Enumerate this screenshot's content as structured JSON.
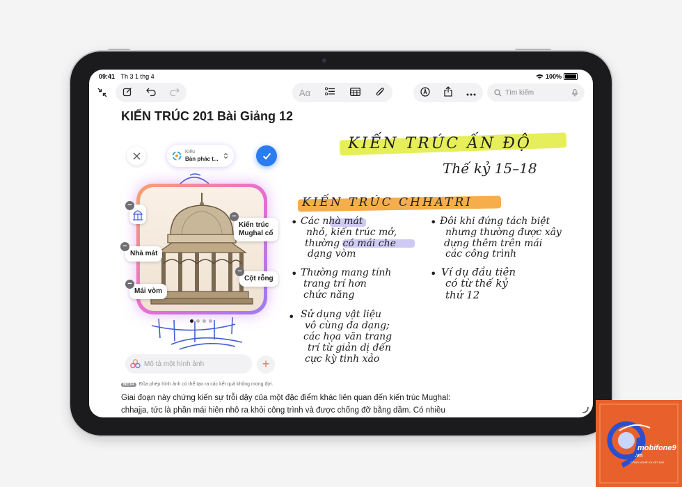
{
  "status_bar": {
    "time": "09:41",
    "date": "Th 3 1 thg 4",
    "battery": "100%"
  },
  "toolbar": {
    "search_placeholder": "Tìm kiếm",
    "format_label": "Aα"
  },
  "note": {
    "title": "KIẾN TRÚC 201 Bài Giảng 12",
    "body": "Giai đoạn này chứng kiến sự trỗi dậy của một đặc điểm khác liên quan đến kiến trúc Mughal: chhajja, tức là phần mái hiên nhô ra khỏi công trình và được chống đỡ bằng dầm. Có nhiều biến"
  },
  "image_playground": {
    "style_label": "Kiểu",
    "style_value": "Bản phác t...",
    "tags": [
      "Kiến trúc Mughal cổ",
      "Nhà mát",
      "Cột rỗng",
      "Mái vòm"
    ],
    "describe_placeholder": "Mô tả một hình ảnh",
    "beta_badge": "BETA",
    "beta_note": "Đũa phép hình ảnh có thể tạo ra các kết quả không mong đợi.",
    "page_dots": 4,
    "active_dot": 1
  },
  "handwriting": {
    "title": "KIẾN TRÚC ẤN ĐỘ",
    "subtitle": "Thế kỷ 15–18",
    "heading": "KIẾN TRÚC CHHATRI",
    "left_bullets": [
      [
        "Các nhà mát",
        "nhỏ, kiến trúc mở,",
        "thường có mái che",
        "dạng vòm"
      ],
      [
        "Thường mang tính",
        "trang trí hơn",
        "chức năng"
      ],
      [
        "Sử dụng vật liệu",
        "vô cùng đa dạng;",
        "các họa văn trang",
        "trí từ giản dị đến",
        "cực kỳ tinh xảo"
      ]
    ],
    "right_bullets": [
      [
        "Đôi khi đứng tách biệt",
        "nhưng thường được xây",
        "dựng thêm trên mái",
        "các công trình"
      ],
      [
        "Ví dụ đầu tiên",
        "có từ thế kỷ",
        "thứ 12"
      ]
    ]
  },
  "watermark": {
    "brand": "mobifone9",
    "domain": ".vn",
    "tagline": "CÔNG NGHỆ VÀ KẾT NỐI"
  },
  "colors": {
    "accent_blue": "#2a7cf0",
    "highlight_yellow": "#e6ef5a",
    "highlight_orange": "#f5a53a",
    "brand_orange": "#e8612c"
  }
}
